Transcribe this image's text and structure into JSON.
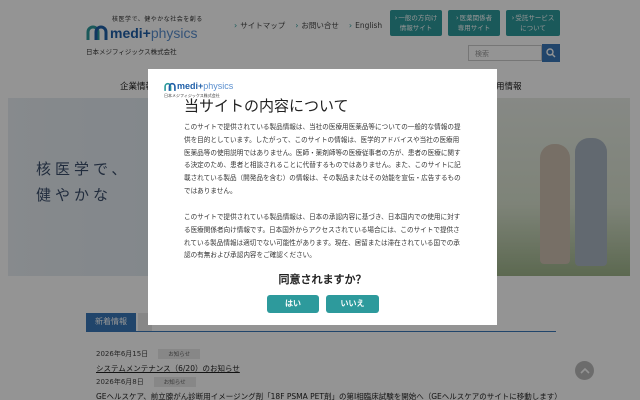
{
  "header": {
    "logo_tagline": "核医学で、健やかな社会を創る",
    "logo_main": "medi+",
    "logo_thin": "physics",
    "company_name": "日本メジフィジックス株式会社",
    "top_links": [
      {
        "label": "サイトマップ"
      },
      {
        "label": "お問い合せ"
      },
      {
        "label": "English"
      }
    ],
    "buttons": {
      "general_line1": "一般の方向け",
      "general_line2": "情報サイト",
      "medical_line1": "医薬関係者",
      "medical_line2": "専用サイト",
      "contract_line1": "受託サービス",
      "contract_line2": "について"
    },
    "search_placeholder": "検索"
  },
  "nav": {
    "left_label": "企業情報",
    "right_label": "用情報"
  },
  "hero": {
    "line1": "核医学で、",
    "line2": "健やかな"
  },
  "news": {
    "tab_label": "新着情報",
    "items": [
      {
        "date": "2026年6月15日",
        "badge": "お知らせ",
        "title": "システムメンテナンス（6/20）のお知らせ"
      },
      {
        "date": "2026年6月8日",
        "badge": "お知らせ",
        "title": "GEヘルスケア、前立腺がん診断用イメージング剤「18F PSMA PET剤」の第Ⅰ相臨床試験を開始へ（GEヘルスケアのサイトに移動します）"
      }
    ]
  },
  "modal": {
    "logo_main": "medi+",
    "logo_thin": "physics",
    "logo_company": "日本メジフィジックス株式会社",
    "title": "当サイトの内容について",
    "paragraph1": "このサイトで提供されている製品情報は、当社の医療用医薬品等についての一般的な情報の提供を目的としています。したがって、このサイトの情報は、医学的アドバイスや当社の医療用医薬品等の使用説明ではありません。医師・薬剤師等の医療従事者の方が、患者の医療に関する決定のため、患者と相談されることに代替するものではありません。また、このサイトに記載されている製品（開発品を含む）の情報は、その製品またはその効能を宣伝・広告するものではありません。",
    "paragraph2": "このサイトで提供されている製品情報は、日本の承認内容に基づき、日本国内での使用に対する医療関係者向け情報です。日本国外からアクセスされている場合には、このサイトで提供されている製品情報は適切でない可能性があります。現在、居留または滞在されている国での承認の有無および承認内容をご確認ください。",
    "question": "同意されますか？",
    "yes_label": "はい",
    "no_label": "いいえ"
  },
  "colors": {
    "teal": "#2d9a9c",
    "brand_blue": "#1f5fa8",
    "tab_blue": "#3a78b8"
  }
}
